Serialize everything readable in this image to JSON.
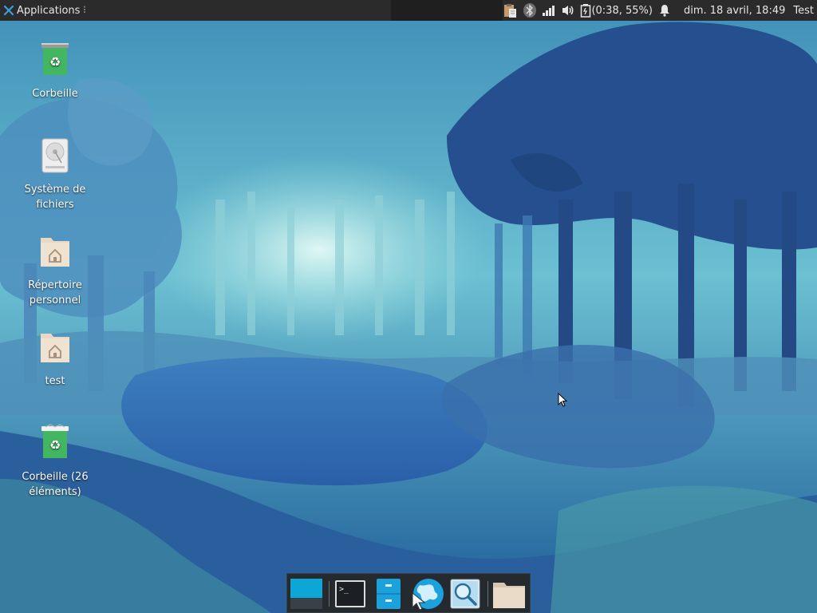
{
  "panel": {
    "applications_label": "Applications",
    "applications_icon": "xfce-logo-icon",
    "battery_text": "(0:38, 55%)",
    "clock": "dim. 18 avril, 18:49",
    "user": "Test",
    "tray_icons": [
      "clipboard-icon",
      "bluetooth-icon",
      "network-signal-icon",
      "volume-icon",
      "battery-icon",
      "notification-bell-icon"
    ]
  },
  "desktop": {
    "icons": [
      {
        "label": "Corbeille",
        "icon": "trash-icon"
      },
      {
        "label": "Système de fichiers",
        "icon": "harddisk-icon"
      },
      {
        "label": "Répertoire personnel",
        "icon": "home-folder-icon"
      },
      {
        "label": "test",
        "icon": "home-folder-icon"
      },
      {
        "label": "Corbeille (26 éléments)",
        "icon": "trash-full-icon"
      }
    ]
  },
  "dock": {
    "items": [
      "show-desktop-icon",
      "terminal-icon",
      "file-manager-icon",
      "web-browser-icon",
      "app-finder-icon",
      "folder-icon"
    ]
  },
  "colors": {
    "panel_bg": "#2b2b2b",
    "dock_bg": "#252a2f",
    "accent": "#0ea5d7",
    "trash_green": "#43b662"
  }
}
